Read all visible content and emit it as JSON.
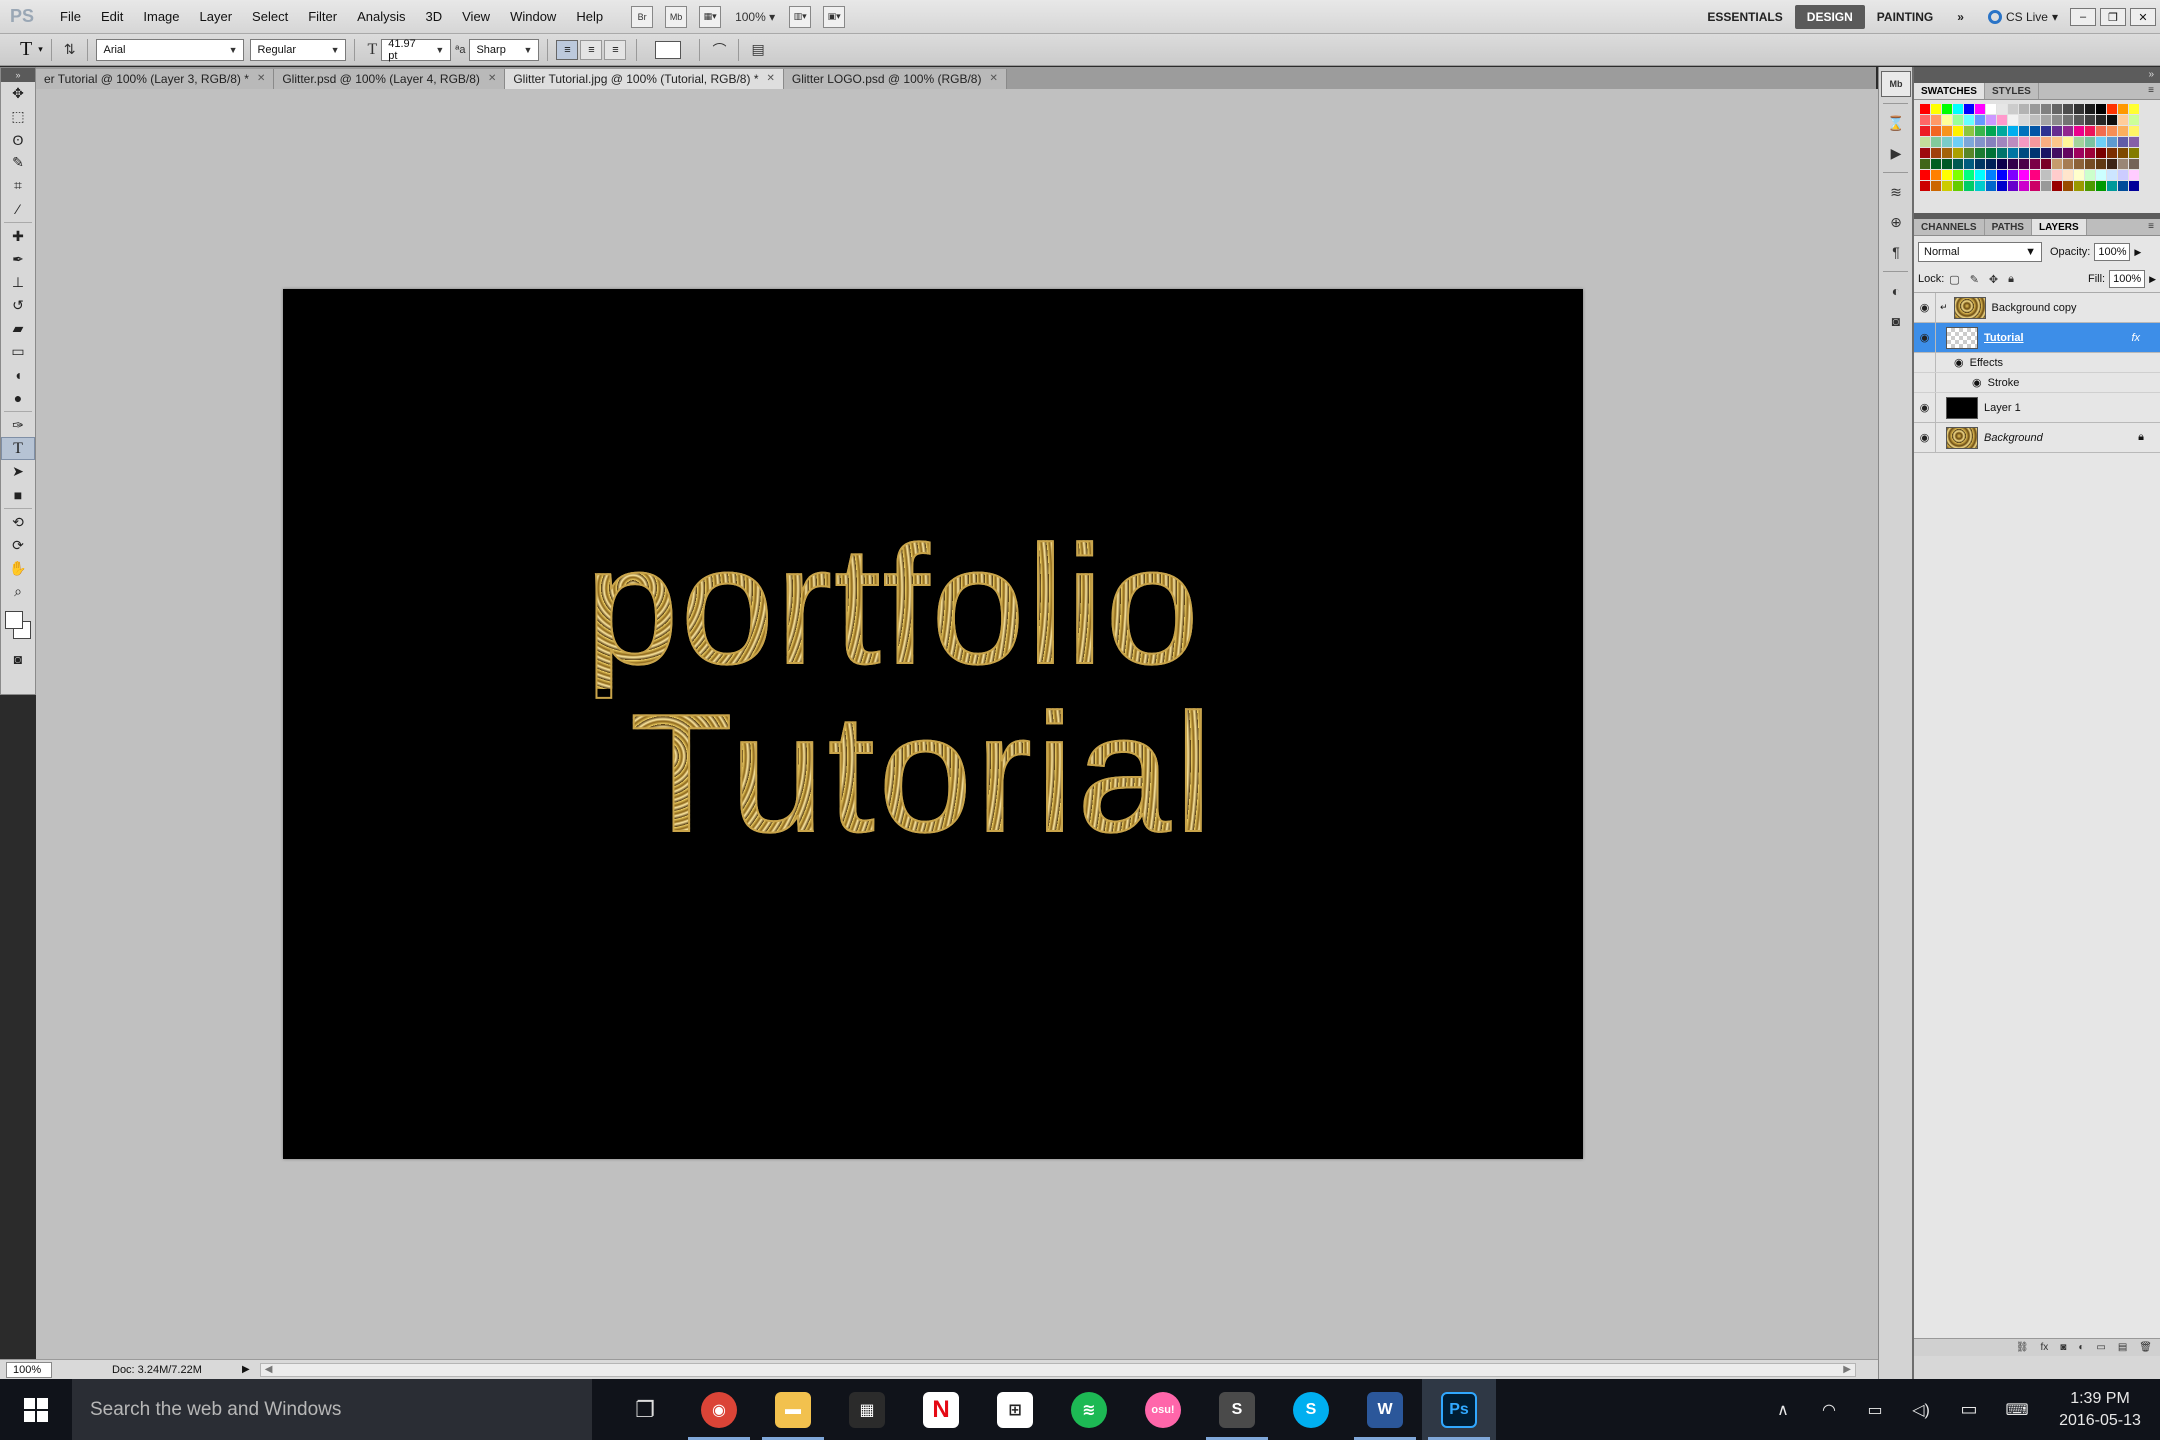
{
  "menu": {
    "logo": "PS",
    "items": [
      "File",
      "Edit",
      "Image",
      "Layer",
      "Select",
      "Filter",
      "Analysis",
      "3D",
      "View",
      "Window",
      "Help"
    ],
    "bridge_label": "Br",
    "minibridge_label": "Mb",
    "zoom_label": "100%",
    "workspaces": [
      "ESSENTIALS",
      "DESIGN",
      "PAINTING"
    ],
    "active_workspace": "DESIGN",
    "cs_live": "CS Live"
  },
  "options": {
    "tool_glyph": "T",
    "font_family": "Arial",
    "font_style": "Regular",
    "font_size": "41.97 pt",
    "aa_label": "a",
    "antialias": "Sharp",
    "text_color": "#ffffff"
  },
  "tabs": [
    {
      "label": "er Tutorial  @ 100% (Layer 3, RGB/8) *",
      "active": false
    },
    {
      "label": "Glitter.psd @ 100% (Layer 4, RGB/8)",
      "active": false
    },
    {
      "label": "Glitter Tutorial.jpg @ 100% (Tutorial, RGB/8) *",
      "active": true
    },
    {
      "label": "Glitter LOGO.psd @ 100% (RGB/8)",
      "active": false
    }
  ],
  "canvas": {
    "line1": "portfolio",
    "line2": "Tutorial",
    "background": "#000000"
  },
  "status": {
    "zoom": "100%",
    "doc": "Doc: 3.24M/7.22M"
  },
  "swatches_panel": {
    "tabs": [
      "SWATCHES",
      "STYLES"
    ],
    "active": "SWATCHES",
    "colors": [
      "#ff0000",
      "#ffff00",
      "#00ff00",
      "#00ffff",
      "#0000ff",
      "#ff00ff",
      "#ffffff",
      "#e6e6e6",
      "#cccccc",
      "#b3b3b3",
      "#999999",
      "#808080",
      "#666666",
      "#4d4d4d",
      "#333333",
      "#1a1a1a",
      "#000000",
      "#ff3300",
      "#ff9900",
      "#ffff33",
      "#ff6666",
      "#ff9966",
      "#ffff99",
      "#99ff99",
      "#66ffff",
      "#6699ff",
      "#cc99ff",
      "#ff99cc",
      "#f2f2f2",
      "#d9d9d9",
      "#bfbfbf",
      "#a6a6a6",
      "#8c8c8c",
      "#737373",
      "#595959",
      "#404040",
      "#262626",
      "#0d0d0d",
      "#ffcc99",
      "#ccff99",
      "#ed1c24",
      "#f26522",
      "#f7941d",
      "#fff200",
      "#8dc63f",
      "#39b54a",
      "#00a651",
      "#00a99d",
      "#00aeef",
      "#0072bc",
      "#0054a6",
      "#2e3192",
      "#662d91",
      "#92278f",
      "#ec008c",
      "#ed145b",
      "#f26c4f",
      "#f68e55",
      "#fbaf5d",
      "#fff568",
      "#c4df9b",
      "#82ca9c",
      "#7accc8",
      "#6dcff6",
      "#7da7d9",
      "#8393ca",
      "#8781bd",
      "#a186be",
      "#bd8cbf",
      "#f49ac2",
      "#f5989d",
      "#f9ad81",
      "#fdc68a",
      "#fff799",
      "#a3d39c",
      "#79c3a1",
      "#6ecff6",
      "#5e9bd0",
      "#605ca8",
      "#855fa8",
      "#9e0b0f",
      "#a0410d",
      "#a36209",
      "#aba000",
      "#598527",
      "#1a7b30",
      "#007236",
      "#00746b",
      "#0076a3",
      "#004b80",
      "#003471",
      "#1b1464",
      "#440e62",
      "#630460",
      "#9e005d",
      "#9e0039",
      "#790000",
      "#7b2e00",
      "#7d4900",
      "#827b00",
      "#406618",
      "#005e20",
      "#005826",
      "#005952",
      "#005b7f",
      "#003663",
      "#002157",
      "#0d004c",
      "#32004b",
      "#4b0049",
      "#7b0046",
      "#7a0026",
      "#c69c6d",
      "#a67c52",
      "#8c6239",
      "#754c24",
      "#603913",
      "#3c2415",
      "#998675",
      "#736357",
      "#ff0000",
      "#ff8000",
      "#ffff00",
      "#80ff00",
      "#00ff80",
      "#00ffff",
      "#0080ff",
      "#0000ff",
      "#8000ff",
      "#ff00ff",
      "#ff0080",
      "#c0c0c0",
      "#ffcccc",
      "#ffe5cc",
      "#ffffcc",
      "#ccffcc",
      "#ccffff",
      "#cce5ff",
      "#ccccff",
      "#ffccff",
      "#cc0000",
      "#cc6600",
      "#cccc00",
      "#66cc00",
      "#00cc66",
      "#00cccc",
      "#0066cc",
      "#0000cc",
      "#6600cc",
      "#cc00cc",
      "#cc0066",
      "#999999",
      "#990000",
      "#994c00",
      "#999900",
      "#4c9900",
      "#009900",
      "#009999",
      "#004c99",
      "#000099"
    ]
  },
  "layers_panel": {
    "tabs": [
      "CHANNELS",
      "PATHS",
      "LAYERS"
    ],
    "active": "LAYERS",
    "blend_mode": "Normal",
    "opacity_label": "Opacity:",
    "opacity": "100%",
    "lock_label": "Lock:",
    "fill_label": "Fill:",
    "fill": "100%",
    "layers": [
      {
        "name": "Background copy",
        "thumb": "glitter",
        "clip": true,
        "selected": false
      },
      {
        "name": "Tutorial",
        "thumb": "checker",
        "clip": false,
        "selected": true,
        "fx": "fx"
      },
      {
        "name": "Layer 1",
        "thumb": "black",
        "clip": false,
        "selected": false
      },
      {
        "name": "Background",
        "thumb": "glitter",
        "clip": false,
        "selected": false,
        "locked": true
      }
    ],
    "effects_label": "Effects",
    "stroke_label": "Stroke"
  },
  "taskbar": {
    "search_placeholder": "Search the web and Windows",
    "time": "1:39 PM",
    "date": "2016-05-13",
    "apps": [
      {
        "name": "task-view",
        "label": "❐",
        "color": "transparent",
        "running": false
      },
      {
        "name": "chrome",
        "label": "◉",
        "color": "#db4437",
        "running": true
      },
      {
        "name": "file-explorer",
        "label": "▬",
        "color": "#f2c14e",
        "running": true
      },
      {
        "name": "calendar",
        "label": "▦",
        "color": "#2b2b2b",
        "running": false
      },
      {
        "name": "netflix",
        "label": "N",
        "color": "#ffffff",
        "running": false
      },
      {
        "name": "store",
        "label": "⊞",
        "color": "#ffffff",
        "running": false
      },
      {
        "name": "spotify",
        "label": "≋",
        "color": "#1db954",
        "running": false
      },
      {
        "name": "osu",
        "label": "osu!",
        "color": "#ff66aa",
        "running": false
      },
      {
        "name": "sublime-text",
        "label": "S",
        "color": "#4a4a4a",
        "running": true
      },
      {
        "name": "skype",
        "label": "S",
        "color": "#00aff0",
        "running": false
      },
      {
        "name": "word",
        "label": "W",
        "color": "#2b579a",
        "running": true
      },
      {
        "name": "photoshop",
        "label": "Ps",
        "color": "#001d34",
        "running": true
      }
    ]
  }
}
